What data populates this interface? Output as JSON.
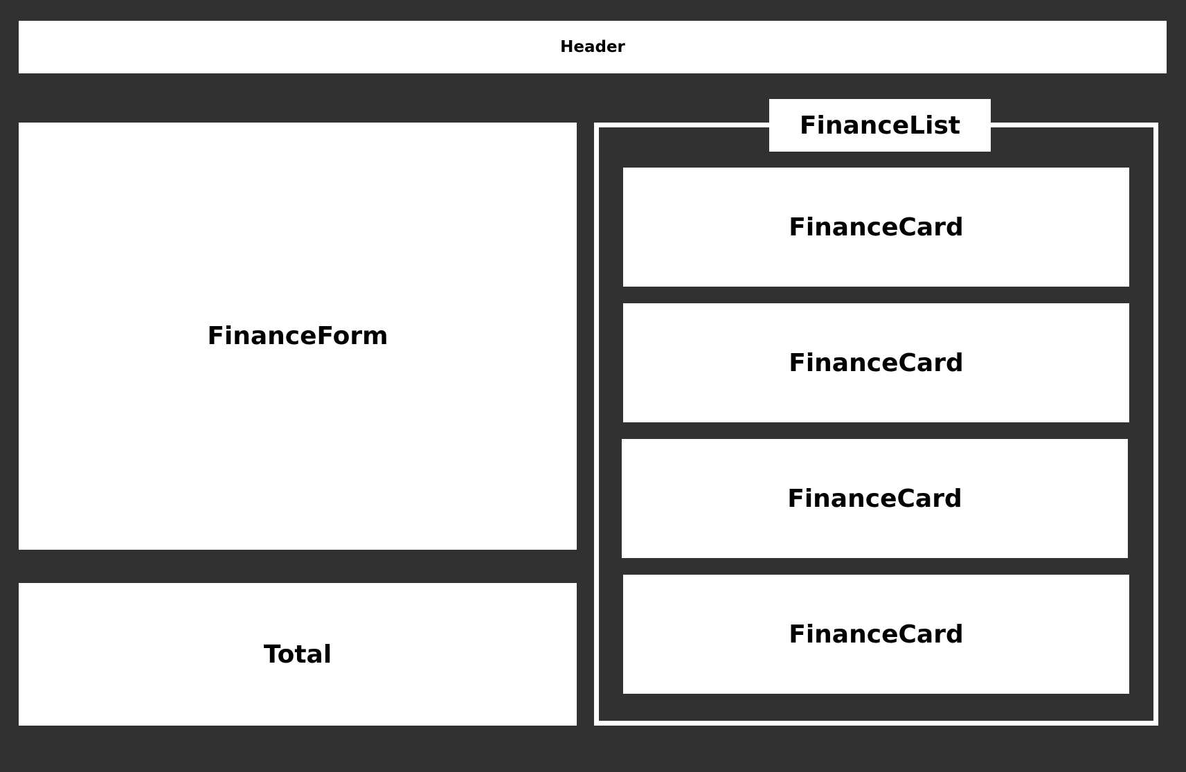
{
  "colors": {
    "background": "#313131",
    "box": "#ffffff",
    "text": "#000000"
  },
  "header": {
    "label": "Header"
  },
  "finance_form": {
    "label": "FinanceForm"
  },
  "total": {
    "label": "Total"
  },
  "finance_list": {
    "title": "FinanceList",
    "cards": [
      {
        "label": "FinanceCard"
      },
      {
        "label": "FinanceCard"
      },
      {
        "label": "FinanceCard"
      },
      {
        "label": "FinanceCard"
      }
    ]
  }
}
